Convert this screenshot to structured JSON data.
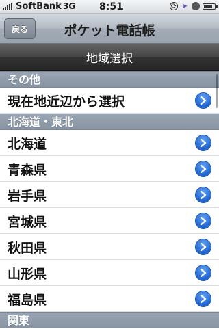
{
  "status_bar": {
    "carrier": "SoftBank",
    "network": "3G",
    "time": "8:51"
  },
  "nav": {
    "back_label": "戻る",
    "title": "ポケット電話帳"
  },
  "subtitle": "地域選択",
  "sections": [
    {
      "header": "その他",
      "items": [
        "現在地近辺から選択"
      ]
    },
    {
      "header": "北海道・東北",
      "items": [
        "北海道",
        "青森県",
        "岩手県",
        "宮城県",
        "秋田県",
        "山形県",
        "福島県"
      ]
    },
    {
      "header": "関東",
      "items": []
    }
  ],
  "colors": {
    "disclosure_blue": "#1f64d3",
    "section_header": "#8c98a6",
    "subbar_dark": "#333333"
  }
}
